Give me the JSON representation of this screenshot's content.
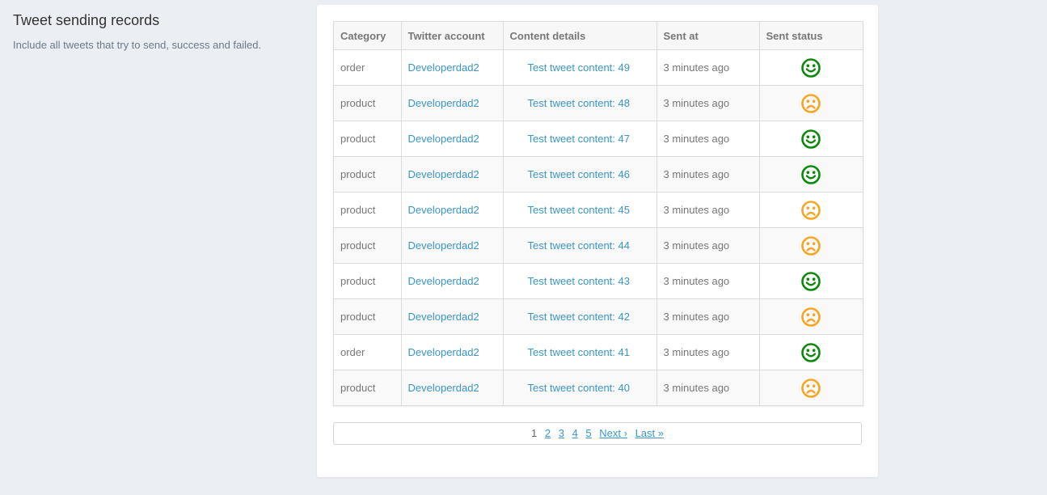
{
  "page": {
    "title": "Tweet sending records",
    "description": "Include all tweets that try to send, success and failed."
  },
  "table": {
    "columns": [
      "Category",
      "Twitter account",
      "Content details",
      "Sent at",
      "Sent status"
    ],
    "rows": [
      {
        "category": "order",
        "account": "Developerdad2",
        "content": "Test tweet content: 49",
        "sent_at": "3 minutes ago",
        "status": "success"
      },
      {
        "category": "product",
        "account": "Developerdad2",
        "content": "Test tweet content: 48",
        "sent_at": "3 minutes ago",
        "status": "failed"
      },
      {
        "category": "product",
        "account": "Developerdad2",
        "content": "Test tweet content: 47",
        "sent_at": "3 minutes ago",
        "status": "success"
      },
      {
        "category": "product",
        "account": "Developerdad2",
        "content": "Test tweet content: 46",
        "sent_at": "3 minutes ago",
        "status": "success"
      },
      {
        "category": "product",
        "account": "Developerdad2",
        "content": "Test tweet content: 45",
        "sent_at": "3 minutes ago",
        "status": "failed"
      },
      {
        "category": "product",
        "account": "Developerdad2",
        "content": "Test tweet content: 44",
        "sent_at": "3 minutes ago",
        "status": "failed"
      },
      {
        "category": "product",
        "account": "Developerdad2",
        "content": "Test tweet content: 43",
        "sent_at": "3 minutes ago",
        "status": "success"
      },
      {
        "category": "product",
        "account": "Developerdad2",
        "content": "Test tweet content: 42",
        "sent_at": "3 minutes ago",
        "status": "failed"
      },
      {
        "category": "order",
        "account": "Developerdad2",
        "content": "Test tweet content: 41",
        "sent_at": "3 minutes ago",
        "status": "success"
      },
      {
        "category": "product",
        "account": "Developerdad2",
        "content": "Test tweet content: 40",
        "sent_at": "3 minutes ago",
        "status": "failed"
      }
    ]
  },
  "icons": {
    "success": "smile-icon",
    "failed": "frown-icon"
  },
  "colors": {
    "success": "#0a8a0a",
    "failed": "#f5a623",
    "link": "#3a95c9"
  },
  "pager": {
    "current": "1",
    "pages": [
      "2",
      "3",
      "4",
      "5"
    ],
    "next": "Next ›",
    "last": "Last »"
  }
}
